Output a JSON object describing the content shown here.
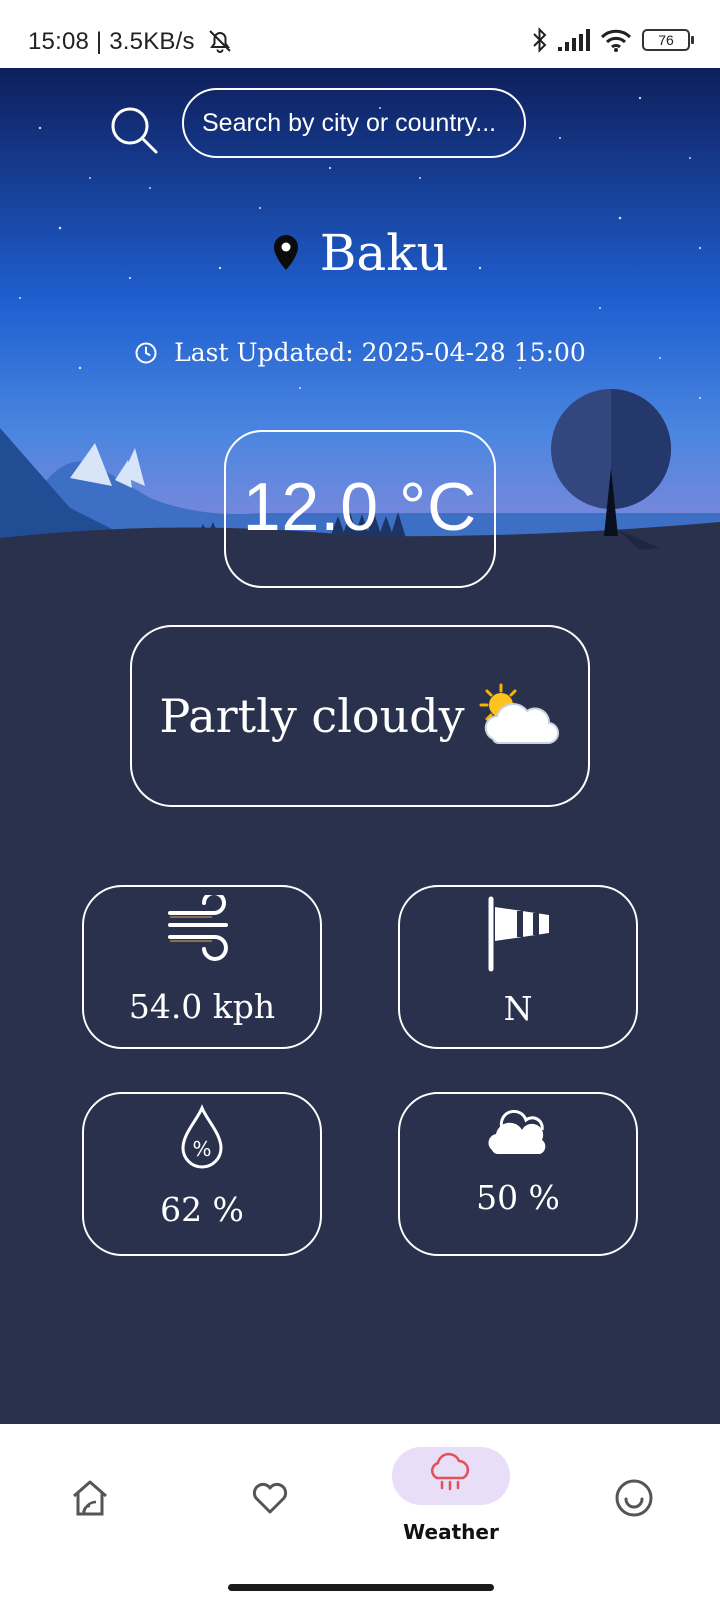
{
  "status_bar": {
    "time_speed": "15:08 | 3.5KB/s",
    "battery": "76"
  },
  "search": {
    "placeholder": "Search by city or country..."
  },
  "location": {
    "city": "Baku",
    "last_updated": "Last Updated: 2025-04-28 15:00"
  },
  "current": {
    "temperature": "12.0 °C",
    "condition": "Partly cloudy"
  },
  "stats": {
    "wind_speed": "54.0 kph",
    "wind_direction": "N",
    "humidity": "62 %",
    "cloud_cover": "50 %"
  },
  "nav": {
    "items": [
      {
        "icon": "home-icon",
        "label": ""
      },
      {
        "icon": "heart-icon",
        "label": ""
      },
      {
        "icon": "rain-cloud-icon",
        "label": "Weather",
        "active": true
      },
      {
        "icon": "smiley-icon",
        "label": ""
      }
    ],
    "active_pill_color": "#e9def8",
    "active_icon_color": "#e0525a"
  },
  "colors": {
    "background": "#2a314d",
    "sky_top": "#0e1f5c",
    "sky_bottom": "#8f86d8"
  }
}
